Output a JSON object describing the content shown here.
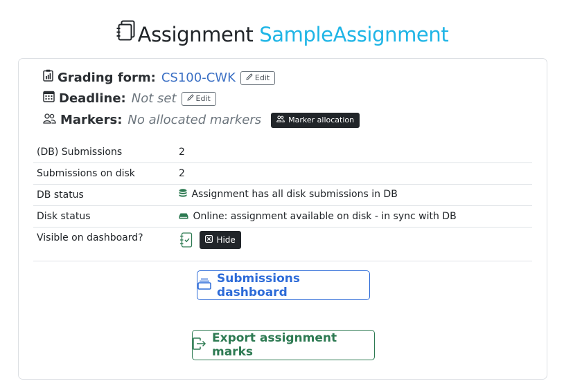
{
  "header": {
    "prefix": "Assignment",
    "name": "SampleAssignment"
  },
  "meta": {
    "grading_form": {
      "label": "Grading form:",
      "value": "CS100-CWK",
      "edit_label": "Edit"
    },
    "deadline": {
      "label": "Deadline:",
      "value": "Not set",
      "edit_label": "Edit"
    },
    "markers": {
      "label": "Markers:",
      "value": "No allocated markers",
      "button_label": "Marker allocation"
    }
  },
  "info": {
    "db_submissions": {
      "key": "(DB) Submissions",
      "value": "2"
    },
    "disk_submissions": {
      "key": "Submissions on disk",
      "value": "2"
    },
    "db_status": {
      "key": "DB status",
      "value": "Assignment has all disk submissions in DB"
    },
    "disk_status": {
      "key": "Disk status",
      "value": "Online: assignment available on disk - in sync with DB"
    },
    "visible": {
      "key": "Visible on dashboard?",
      "button_label": "Hide"
    }
  },
  "actions": {
    "submissions_dashboard": "Submissions dashboard",
    "export_marks": "Export assignment marks"
  },
  "colors": {
    "title_accent": "#1fb5e6",
    "link": "#3a6fc4",
    "primary": "#2d6bd8",
    "success": "#2d7a52",
    "dark_button": "#212529"
  },
  "icons": [
    "journals-icon",
    "clipboard-data-icon",
    "calendar-icon",
    "people-icon",
    "pencil-icon",
    "database-icon",
    "hdd-icon",
    "journal-check-icon",
    "x-square-icon",
    "collection-icon",
    "box-arrow-right-icon"
  ]
}
